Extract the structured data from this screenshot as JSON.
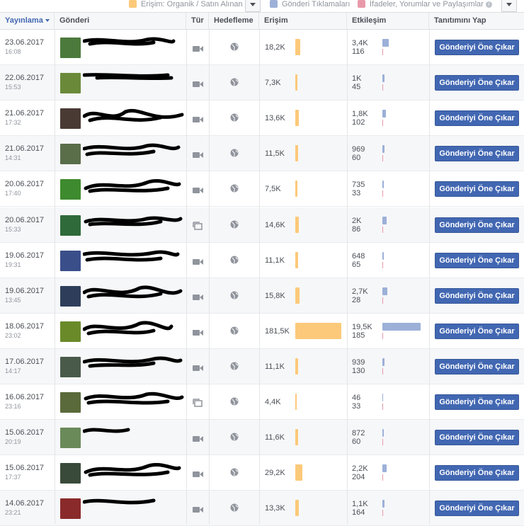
{
  "legend": {
    "reach": {
      "label": "Erişim: Organik / Satın Alınan",
      "color": "#fcc97a"
    },
    "clicks": {
      "label": "Gönderi Tıklamaları",
      "color": "#9cb0d8"
    },
    "reactions": {
      "label": "İfadeler, Yorumlar ve Paylaşımlar",
      "color": "#e899a9"
    }
  },
  "header": {
    "published": "Yayınlama",
    "post": "Gönderi",
    "type": "Tür",
    "targeting": "Hedefleme",
    "reach": "Erişim",
    "engagement": "Etkileşim",
    "promote": "Tanıtımını Yap"
  },
  "boost_label": "Gönderiyi Öne Çıkar",
  "rows": [
    {
      "date": "23.06.2017",
      "time": "16:08",
      "type": "video",
      "reach": "18,2K",
      "reach_value": 18.2,
      "eng_top": "3,4K",
      "eng_bottom": "116",
      "clicks_value": 3.4,
      "thumb": "#4c7a3c"
    },
    {
      "date": "22.06.2017",
      "time": "15:53",
      "type": "video",
      "reach": "7,3K",
      "reach_value": 7.3,
      "eng_top": "1K",
      "eng_bottom": "45",
      "clicks_value": 1.0,
      "thumb": "#6a8a3a"
    },
    {
      "date": "21.06.2017",
      "time": "17:32",
      "type": "video",
      "reach": "13,6K",
      "reach_value": 13.6,
      "eng_top": "1,8K",
      "eng_bottom": "102",
      "clicks_value": 1.8,
      "thumb": "#4a3a34"
    },
    {
      "date": "21.06.2017",
      "time": "14:31",
      "type": "video",
      "reach": "11,5K",
      "reach_value": 11.5,
      "eng_top": "969",
      "eng_bottom": "60",
      "clicks_value": 0.97,
      "thumb": "#5a6e4a"
    },
    {
      "date": "20.06.2017",
      "time": "17:40",
      "type": "video",
      "reach": "7,5K",
      "reach_value": 7.5,
      "eng_top": "735",
      "eng_bottom": "33",
      "clicks_value": 0.74,
      "thumb": "#3e8a2e"
    },
    {
      "date": "20.06.2017",
      "time": "15:33",
      "type": "album",
      "reach": "14,6K",
      "reach_value": 14.6,
      "eng_top": "2K",
      "eng_bottom": "86",
      "clicks_value": 2.0,
      "thumb": "#2f6a3a"
    },
    {
      "date": "19.06.2017",
      "time": "19:31",
      "type": "video",
      "reach": "11,1K",
      "reach_value": 11.1,
      "eng_top": "648",
      "eng_bottom": "65",
      "clicks_value": 0.65,
      "thumb": "#3a4e8a"
    },
    {
      "date": "19.06.2017",
      "time": "13:45",
      "type": "video",
      "reach": "15,8K",
      "reach_value": 15.8,
      "eng_top": "2,7K",
      "eng_bottom": "28",
      "clicks_value": 2.7,
      "thumb": "#2e3e5a"
    },
    {
      "date": "18.06.2017",
      "time": "23:02",
      "type": "video",
      "reach": "181,5K",
      "reach_value": 181.5,
      "eng_top": "19,5K",
      "eng_bottom": "185",
      "clicks_value": 19.5,
      "thumb": "#6a8a2a"
    },
    {
      "date": "17.06.2017",
      "time": "14:17",
      "type": "video",
      "reach": "11,1K",
      "reach_value": 11.1,
      "eng_top": "939",
      "eng_bottom": "130",
      "clicks_value": 0.94,
      "thumb": "#4a5a4a"
    },
    {
      "date": "16.06.2017",
      "time": "23:16",
      "type": "album",
      "reach": "4,4K",
      "reach_value": 4.4,
      "eng_top": "46",
      "eng_bottom": "33",
      "clicks_value": 0.05,
      "thumb": "#5a6a3a"
    },
    {
      "date": "15.06.2017",
      "time": "20:19",
      "type": "video",
      "reach": "11,6K",
      "reach_value": 11.6,
      "eng_top": "872",
      "eng_bottom": "60",
      "clicks_value": 0.87,
      "thumb": "#6a8a5a"
    },
    {
      "date": "15.06.2017",
      "time": "17:37",
      "type": "video",
      "reach": "29,2K",
      "reach_value": 29.2,
      "eng_top": "2,2K",
      "eng_bottom": "204",
      "clicks_value": 2.2,
      "thumb": "#3a4a3a"
    },
    {
      "date": "14.06.2017",
      "time": "23:21",
      "type": "video",
      "reach": "13,3K",
      "reach_value": 13.3,
      "eng_top": "1,1K",
      "eng_bottom": "164",
      "clicks_value": 1.1,
      "thumb": "#8a2a2a"
    }
  ]
}
